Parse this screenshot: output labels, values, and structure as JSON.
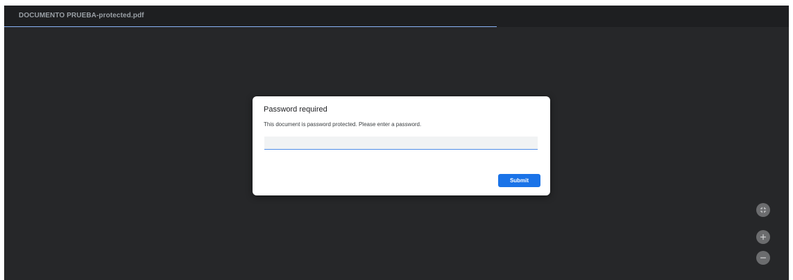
{
  "tab": {
    "file_name": "DOCUMENTO PRUEBA-protected.pdf"
  },
  "dialog": {
    "title": "Password required",
    "message": "This document is password protected. Please enter a password.",
    "password_value": "",
    "submit_label": "Submit"
  },
  "controls": [
    {
      "name": "fit-to-page-icon"
    },
    {
      "name": "zoom-in-icon"
    },
    {
      "name": "zoom-out-icon"
    }
  ],
  "colors": {
    "accent": "#1a73e8",
    "tab_underline": "#8ab4f8",
    "viewer_background": "#262729",
    "titlebar_background": "#1e1f21"
  }
}
